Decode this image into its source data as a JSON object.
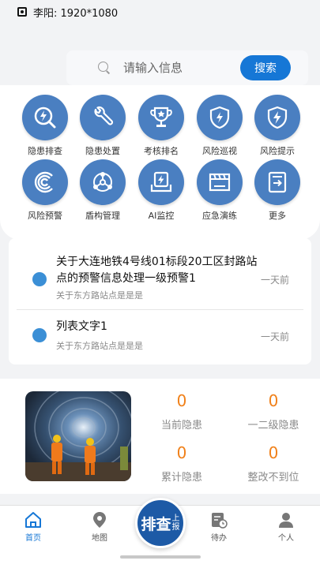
{
  "status": {
    "text": "李阳: 1920*1080"
  },
  "search": {
    "placeholder": "请输入信息",
    "button": "搜索"
  },
  "grid": {
    "items": [
      {
        "label": "隐患排查",
        "icon": "search-lightning-icon"
      },
      {
        "label": "隐患处置",
        "icon": "wrench-icon"
      },
      {
        "label": "考核排名",
        "icon": "trophy-icon"
      },
      {
        "label": "风险巡视",
        "icon": "shield-icon"
      },
      {
        "label": "风险提示",
        "icon": "shield-lightning-icon"
      },
      {
        "label": "风险预警",
        "icon": "signal-icon"
      },
      {
        "label": "盾构管理",
        "icon": "network-icon"
      },
      {
        "label": "AI监控",
        "icon": "ai-monitor-icon"
      },
      {
        "label": "应急演练",
        "icon": "clapperboard-icon"
      },
      {
        "label": "更多",
        "icon": "more-icon"
      }
    ]
  },
  "notices": [
    {
      "title": "关于大连地铁4号线01标段20工区封路站点的预警信息处理一级预警1",
      "sub": "关于东方路站点是是是",
      "time": "一天前"
    },
    {
      "title": "列表文字1",
      "sub": "关于东方路站点是是是",
      "time": "一天前"
    }
  ],
  "stats": [
    {
      "value": "0",
      "label": "当前隐患"
    },
    {
      "value": "0",
      "label": "一二级隐患"
    },
    {
      "value": "0",
      "label": "累计隐患"
    },
    {
      "value": "0",
      "label": "整改不到位"
    }
  ],
  "tabbar": {
    "home": "首页",
    "map": "地图",
    "todo": "待办",
    "profile": "个人",
    "center_big": "排查",
    "center_small": "上报"
  },
  "colors": {
    "accent": "#1677d6",
    "icon_circle": "#4a7fc1",
    "stat_number": "#f08019",
    "center_button": "#1d5aa6"
  }
}
